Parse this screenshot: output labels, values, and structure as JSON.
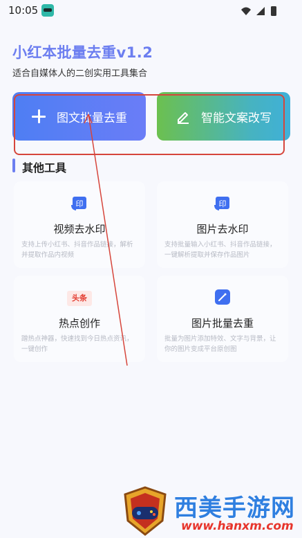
{
  "status_bar": {
    "time": "10:05"
  },
  "header": {
    "title": "小红本批量去重v1.2",
    "subtitle": "适合自媒体人的二创实用工具集合"
  },
  "actions": {
    "dedupe_label": "图文批量去重",
    "rewrite_label": "智能文案改写"
  },
  "section": {
    "title": "其他工具"
  },
  "tools": [
    {
      "name": "视频去水印",
      "desc": "支持上传小红书、抖音作品链接，解析并提取作品内视频",
      "icon": "watermark-icon"
    },
    {
      "name": "图片去水印",
      "desc": "支持批量输入小红书、抖音作品链接，一键解析提取并保存作品图片",
      "icon": "watermark-icon"
    },
    {
      "name": "热点创作",
      "desc": "蹭热点神器，快速找到今日热点资讯，一键创作",
      "icon": "toutiao-icon",
      "icon_text": "头条"
    },
    {
      "name": "图片批量去重",
      "desc": "批量为图片添加特效、文字与背景，让你的图片变成平台原创图",
      "icon": "magic-wand-icon"
    }
  ],
  "icon_text": {
    "watermark": "印"
  },
  "watermark": {
    "title": "西美手游网",
    "url": "www.hanxm.com"
  },
  "colors": {
    "accent": "#6c7ef0",
    "annotation": "#d6453b"
  }
}
